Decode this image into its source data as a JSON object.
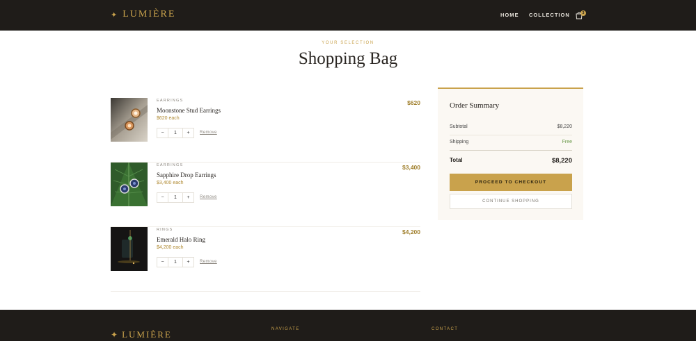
{
  "header": {
    "brand_mark": "✦",
    "brand": "LUMIÈRE",
    "nav": {
      "home": "HOME",
      "collection": "COLLECTION"
    },
    "cart_icon": "bag-icon",
    "cart_count": "3"
  },
  "page": {
    "eyebrow": "YOUR SELECTION",
    "title": "Shopping Bag"
  },
  "cart": {
    "items": [
      {
        "category": "EARRINGS",
        "name": "Moonstone Stud Earrings",
        "each": "$620 each",
        "qty": "1",
        "minus": "−",
        "plus": "+",
        "remove": "Remove",
        "price": "$620"
      },
      {
        "category": "EARRINGS",
        "name": "Sapphire Drop Earrings",
        "each": "$3,400 each",
        "qty": "1",
        "minus": "−",
        "plus": "+",
        "remove": "Remove",
        "price": "$3,400"
      },
      {
        "category": "RINGS",
        "name": "Emerald Halo Ring",
        "each": "$4,200 each",
        "qty": "1",
        "minus": "−",
        "plus": "+",
        "remove": "Remove",
        "price": "$4,200"
      }
    ]
  },
  "summary": {
    "title": "Order Summary",
    "subtotal_label": "Subtotal",
    "subtotal_value": "$8,220",
    "shipping_label": "Shipping",
    "shipping_value": "Free",
    "total_label": "Total",
    "total_value": "$8,220",
    "checkout_label": "PROCEED TO CHECKOUT",
    "continue_label": "CONTINUE SHOPPING"
  },
  "footer": {
    "brand_mark": "✦",
    "brand": "LUMIÈRE",
    "navigate_heading": "NAVIGATE",
    "contact_heading": "CONTACT"
  },
  "colors": {
    "accent_gold": "#c9a24c",
    "dark_bg": "#1f1c19",
    "summary_bg": "#fbf8f3",
    "free_green": "#6a9a4a"
  }
}
